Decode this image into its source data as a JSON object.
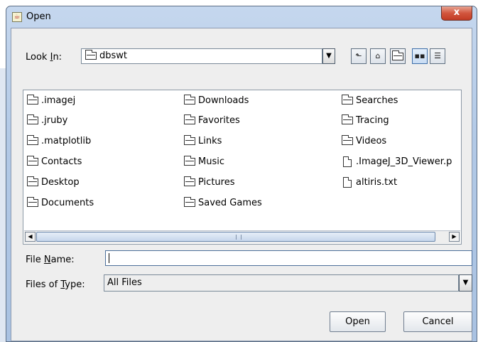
{
  "window": {
    "title": "Open",
    "close_glyph": "x"
  },
  "lookin": {
    "label_pre": "Look ",
    "label_mnemonic": "I",
    "label_post": "n:",
    "value": "dbswt"
  },
  "toolbar": {
    "up_icon": "up-one-level-icon",
    "home_icon": "home-icon",
    "new_folder_icon": "new-folder-icon",
    "list_icon": "list-view-icon",
    "details_icon": "details-view-icon"
  },
  "files": {
    "col1": [
      ".imagej",
      ".jruby",
      ".matplotlib",
      "Contacts",
      "Desktop",
      "Documents"
    ],
    "col2": [
      "Downloads",
      "Favorites",
      "Links",
      "Music",
      "Pictures",
      "Saved Games"
    ],
    "col3": [
      "Searches",
      "Tracing",
      "Videos",
      ".ImageJ_3D_Viewer.p",
      "altiris.txt"
    ]
  },
  "filename": {
    "label_pre": "File ",
    "label_mnemonic": "N",
    "label_post": "ame:",
    "value": ""
  },
  "filetype": {
    "label_pre": "Files of ",
    "label_mnemonic": "T",
    "label_post": "ype:",
    "value": "All Files"
  },
  "buttons": {
    "open": "Open",
    "cancel": "Cancel"
  },
  "colors": {
    "selection_accent": "#6d89ad",
    "close_button": "#d2563e"
  }
}
